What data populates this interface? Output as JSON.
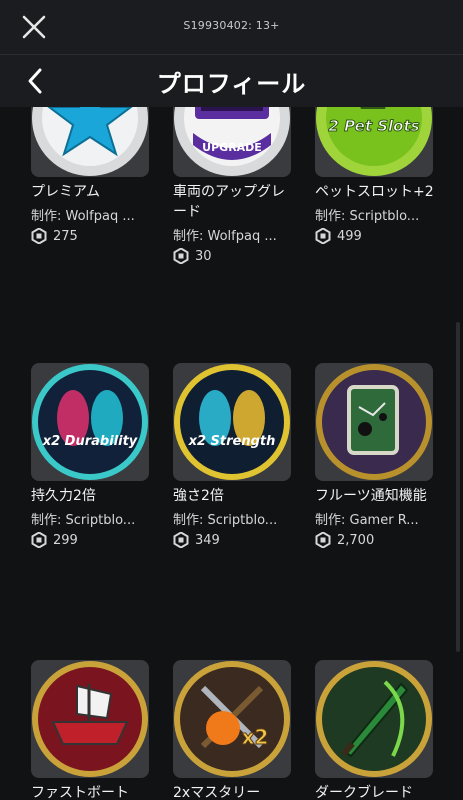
{
  "topbar": {
    "session_label": "S19930402: 13+"
  },
  "header": {
    "title": "プロフィール"
  },
  "items": [
    {
      "name": "プレミアム",
      "creator": "制作: Wolfpaq ...",
      "price": "275",
      "icon": "star-badge-icon"
    },
    {
      "name": "車両のアップグレード",
      "creator": "制作: Wolfpaq ...",
      "price": "30",
      "icon": "upgrade-badge-icon"
    },
    {
      "name": "ペットスロット+2",
      "creator": "制作: Scriptblo...",
      "price": "499",
      "icon": "pet-slots-badge-icon"
    },
    {
      "name": "持久力2倍",
      "creator": "制作: Scriptblo...",
      "price": "299",
      "icon": "x2-durability-badge-icon"
    },
    {
      "name": "強さ2倍",
      "creator": "制作: Scriptblo...",
      "price": "349",
      "icon": "x2-strength-badge-icon"
    },
    {
      "name": "フルーツ通知機能",
      "creator": "制作: Gamer R...",
      "price": "2,700",
      "icon": "fruit-notifier-badge-icon"
    },
    {
      "name": "ファストボート",
      "creator": "",
      "price": "",
      "icon": "fast-boat-badge-icon"
    },
    {
      "name": "2xマスタリー",
      "creator": "",
      "price": "",
      "icon": "x2-mastery-badge-icon"
    },
    {
      "name": "ダークブレード",
      "creator": "",
      "price": "",
      "icon": "dark-blade-badge-icon"
    }
  ],
  "colors": {
    "background": "#111214",
    "bar": "#1b1c1f",
    "thumb": "#393b3f"
  }
}
